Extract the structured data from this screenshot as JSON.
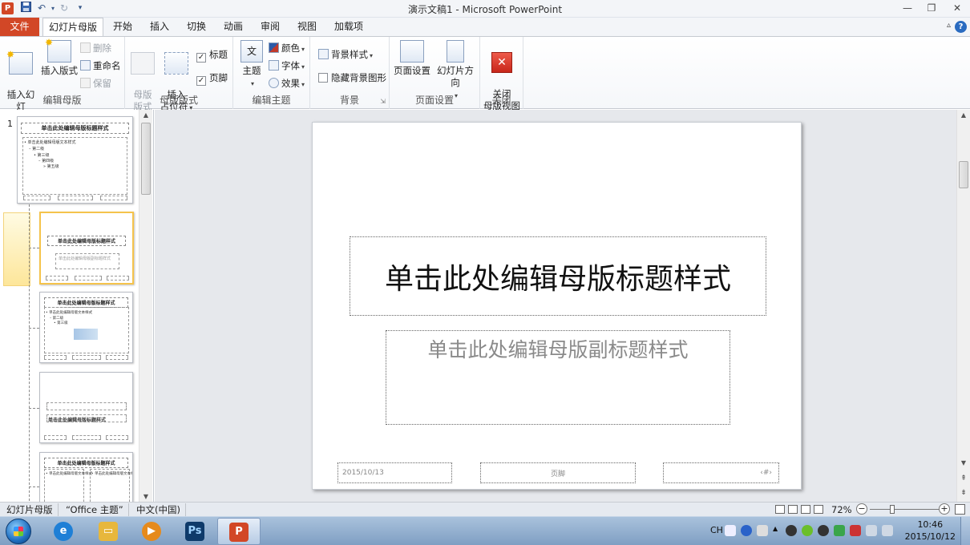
{
  "window": {
    "title": "演示文稿1 - Microsoft PowerPoint",
    "app_icon_letter": "P",
    "qat": {
      "save_icon": "save-icon",
      "undo_icon": "undo-icon",
      "redo_icon": "redo-icon",
      "customize_icon": "customize-qat-icon"
    },
    "controls": {
      "minimize": "—",
      "restore": "❐",
      "close": "✕"
    }
  },
  "tabs": {
    "file": "文件",
    "items": [
      "幻灯片母版",
      "开始",
      "插入",
      "切换",
      "动画",
      "审阅",
      "视图",
      "加载项"
    ],
    "active": "幻灯片母版",
    "help": "?",
    "minimize_ribbon": "▵"
  },
  "ribbon": {
    "edit_master": {
      "label": "编辑母版",
      "insert_slide_master": "插入幻灯\n片母版",
      "insert_layout": "插入版式",
      "delete": "删除",
      "rename": "重命名",
      "preserve": "保留"
    },
    "master_layout": {
      "label": "母版版式",
      "master_layout_btn": "母版\n版式",
      "insert_placeholder": "插入\n占位符",
      "title_checkbox": "标题",
      "title_checked": true,
      "footer_checkbox": "页脚",
      "footer_checked": true
    },
    "edit_theme": {
      "label": "编辑主题",
      "themes": "主题",
      "colors": "颜色",
      "fonts": "字体",
      "effects": "效果"
    },
    "background": {
      "label": "背景",
      "background_styles": "背景样式",
      "hide_background_graphics": "隐藏背景图形",
      "hide_checked": false
    },
    "page_setup": {
      "label": "页面设置",
      "page_setup_btn": "页面设置",
      "slide_orientation": "幻灯片方向"
    },
    "close": {
      "label": "关闭",
      "close_master_view": "关闭\n母版视图"
    }
  },
  "thumbnails": {
    "master_number": "1",
    "master_title": "单击此处编辑母版标题样式",
    "master_body": [
      "• 单击此处编辑母版文本样式",
      "– 第二级",
      "• 第三级",
      "– 第四级",
      "» 第五级"
    ],
    "layout_title": "单击此处编辑母版标题样式",
    "layout_subtitle": "单击此处编辑母版副标题样式"
  },
  "slide": {
    "title_placeholder": "单击此处编辑母版标题样式",
    "subtitle_placeholder": "单击此处编辑母版副标题样式",
    "footer_date": "2015/10/13",
    "footer_text": "页脚",
    "footer_number": "‹#›"
  },
  "statusbar": {
    "view": "幻灯片母版",
    "theme": "“Office 主题”",
    "language": "中文(中国)",
    "zoom": "72%",
    "zoom_minus": "−",
    "zoom_plus": "+"
  },
  "taskbar": {
    "apps": [
      {
        "name": "ie",
        "icon": "ie-icon",
        "glyph": "e",
        "color": "#1e7fd6"
      },
      {
        "name": "explorer",
        "icon": "folder-icon",
        "glyph": "▭",
        "color": "#e7b73c"
      },
      {
        "name": "media",
        "icon": "media-player-icon",
        "glyph": "▶",
        "color": "#e68a1c"
      },
      {
        "name": "photoshop",
        "icon": "photoshop-icon",
        "glyph": "Ps",
        "color": "#0e3a6a"
      },
      {
        "name": "powerpoint",
        "icon": "powerpoint-icon",
        "glyph": "P",
        "color": "#d24726"
      }
    ],
    "tray_lang": "CH",
    "clock_time": "10:46",
    "clock_date": "2015/10/12"
  }
}
